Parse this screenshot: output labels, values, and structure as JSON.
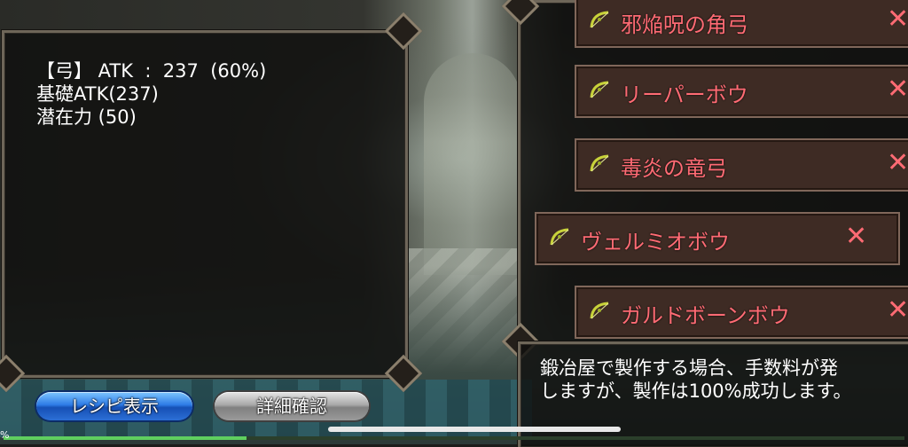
{
  "stats": {
    "line1": "【弓】 ATK  :  237  (60%)",
    "line2": "基礎ATK(237)",
    "line3": "潜在力 (50)"
  },
  "bow_list": {
    "items": [
      {
        "name": "邪焔呪の角弓",
        "remove": "✕"
      },
      {
        "name": "リーパーボウ",
        "remove": "✕"
      },
      {
        "name": "毒炎の竜弓",
        "remove": "✕"
      },
      {
        "name": "ヴェルミオボウ",
        "remove": "✕"
      },
      {
        "name": "ガルドボーンボウ",
        "remove": "✕"
      }
    ],
    "selected_index": 3
  },
  "info": {
    "line1": "鍛冶屋で製作する場合、手数料が発",
    "line2": "しますが、製作は100%成功します。"
  },
  "buttons": {
    "recipe": "レシピ表示",
    "detail": "詳細確認"
  },
  "bottom": {
    "percent_glyph": "%",
    "progress_fraction": 0.27
  },
  "colors": {
    "item_text": "#ff6b74",
    "recipe_button": "#2e7ce6",
    "detail_button": "#a9a9a9"
  },
  "icon": "bow-icon"
}
